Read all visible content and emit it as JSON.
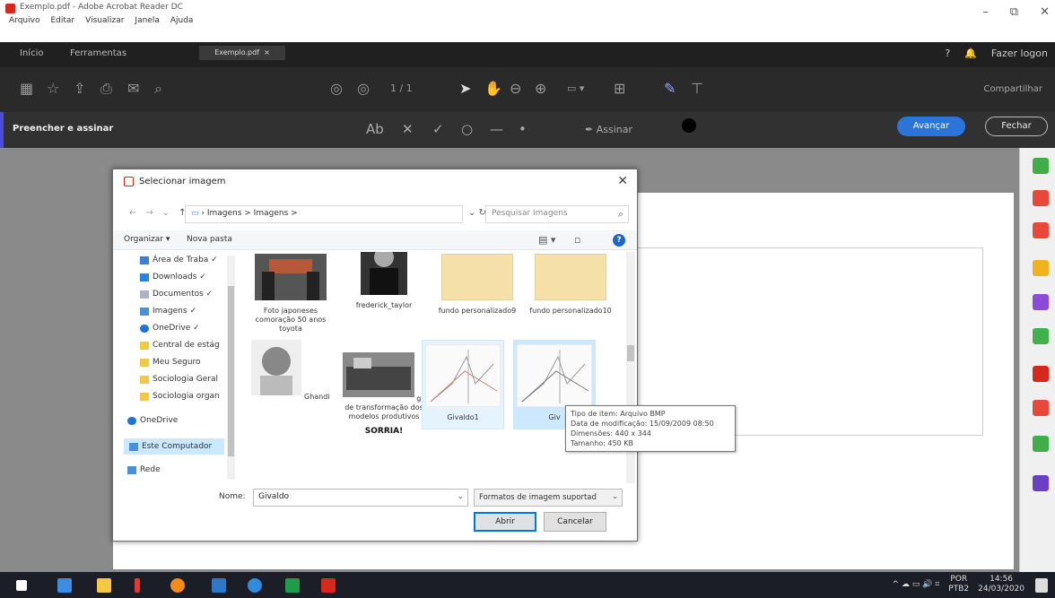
{
  "window": {
    "title": "Exemplo.pdf - Adobe Acrobat Reader DC",
    "menu": [
      "Arquivo",
      "Editar",
      "Visualizar",
      "Janela",
      "Ajuda"
    ]
  },
  "tabs": {
    "home": "Início",
    "tools": "Ferramentas",
    "file": "Exemplo.pdf",
    "login": "Fazer logon"
  },
  "toolbar": {
    "right_label": "Compartilhar"
  },
  "editbar": {
    "label": "Preencher e assinar",
    "sign_label": "Assinar",
    "advance_button": "Avançar",
    "close_button": "Fechar"
  },
  "dialog": {
    "title": "Selecionar imagem",
    "path": "Imagens > Imagens >",
    "search_placeholder": "Pesquisar Imagens",
    "organize": "Organizar ▾",
    "new_folder": "Nova pasta",
    "nav_items": [
      {
        "label": "Área de Traba ✓",
        "icon_color": "#3b7fd4"
      },
      {
        "label": "Downloads ✓",
        "icon_color": "#2a82e0"
      },
      {
        "label": "Documentos ✓",
        "icon_color": "#aab4c4"
      },
      {
        "label": "Imagens ✓",
        "icon_color": "#4a90d9"
      },
      {
        "label": "OneDrive ✓",
        "icon_color": "#1c75d8"
      },
      {
        "label": "Central de estág",
        "icon_color": "#f3c844"
      },
      {
        "label": "Meu Seguro",
        "icon_color": "#f3c844"
      },
      {
        "label": "Sociologia Geral",
        "icon_color": "#f3c844"
      },
      {
        "label": "Sociologia organ",
        "icon_color": "#f3c844"
      },
      {
        "label": "OneDrive",
        "icon_color": "#1c75d8"
      },
      {
        "label": "Este Computador",
        "icon_color": "#4a90d9"
      },
      {
        "label": "Rede",
        "icon_color": "#4a90d9"
      }
    ],
    "files": [
      {
        "name": "Foto japoneses comoração 50 anos toyota"
      },
      {
        "name": "frederick_taylor"
      },
      {
        "name": "fundo personalizado9"
      },
      {
        "name": "fundo personalizado10"
      },
      {
        "name": "Ghandi"
      },
      {
        "name": "gif de transformação dos modelos produtivos"
      },
      {
        "name": "Givaldo1"
      },
      {
        "name": "Giv"
      }
    ],
    "partial_file_text": "SORRIA!",
    "tooltip": {
      "line1": "Tipo de item: Arquivo BMP",
      "line2": "Data de modificação: 15/09/2009 08:50",
      "line3": "Dimensões: 440 x 344",
      "line4": "Tamanho: 450 KB"
    },
    "name_label": "Nome:",
    "name_value": "Givaldo",
    "filter_value": "Formatos de imagem suportad",
    "open_button": "Abrir",
    "cancel_button": "Cancelar"
  },
  "taskbar": {
    "lang": "POR",
    "layout": "PTB2",
    "time": "14:56",
    "date": "24/03/2020"
  }
}
